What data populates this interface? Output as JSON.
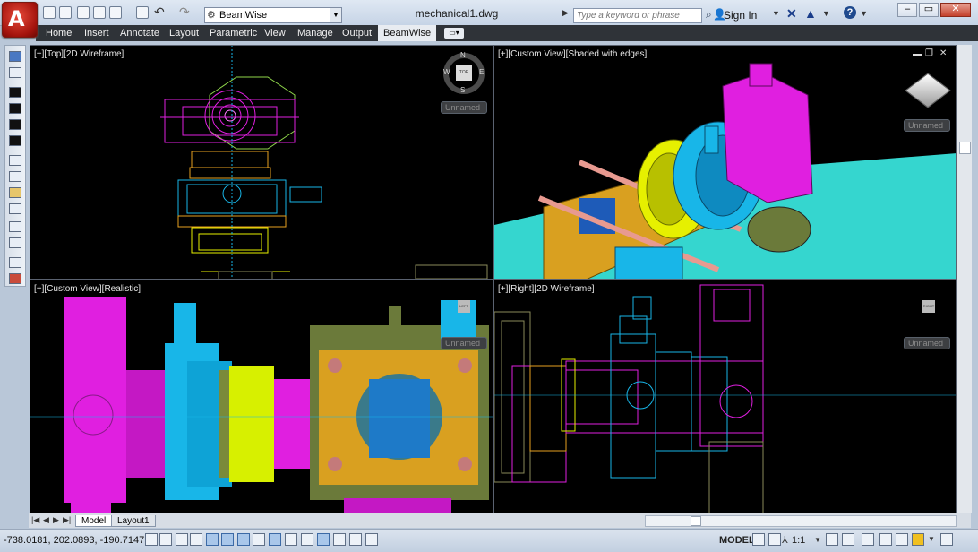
{
  "window": {
    "document_title": "mechanical1.dwg",
    "workspace": "BeamWise",
    "search_placeholder": "Type a keyword or phrase",
    "sign_in": "Sign In"
  },
  "ribbon_tabs": [
    {
      "label": "Home"
    },
    {
      "label": "Insert"
    },
    {
      "label": "Annotate"
    },
    {
      "label": "Layout"
    },
    {
      "label": "Parametric"
    },
    {
      "label": "View"
    },
    {
      "label": "Manage"
    },
    {
      "label": "Output"
    },
    {
      "label": "BeamWise",
      "active": true
    }
  ],
  "viewports": {
    "top_left": {
      "label": "[+][Top][2D Wireframe]",
      "cube_face": "TOP",
      "compass": [
        "N",
        "E",
        "S",
        "W"
      ],
      "view_name": "Unnamed"
    },
    "top_right": {
      "label": "[+][Custom View][Shaded with edges]",
      "view_name": "Unnamed"
    },
    "bottom_left": {
      "label": "[+][Custom View][Realistic]",
      "cube_face": "LEFT",
      "view_name": "Unnamed"
    },
    "bottom_right": {
      "label": "[+][Right][2D Wireframe]",
      "cube_face": "RIGHT",
      "view_name": "Unnamed"
    }
  },
  "layout_tabs": [
    {
      "label": "Model",
      "active": true
    },
    {
      "label": "Layout1"
    }
  ],
  "status": {
    "coordinates": "-738.0181, 202.0893, -190.7147",
    "space": "MODEL",
    "annotation_scale": "1:1"
  },
  "colors": {
    "accent_magenta": "#e01fe0",
    "accent_cyan": "#18b6e8",
    "accent_yellow": "#e6f000",
    "accent_orange": "#d9a020",
    "viewport_bg": "#000000",
    "floor_cyan": "#35d6cf"
  }
}
